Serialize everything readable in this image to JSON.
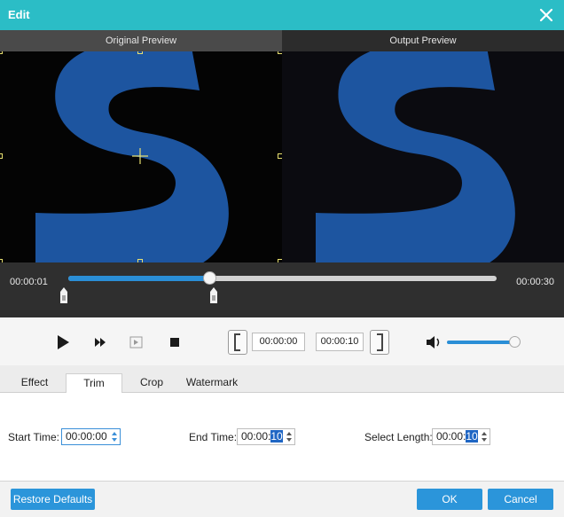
{
  "window": {
    "title": "Edit"
  },
  "preview": {
    "original_label": "Original Preview",
    "output_label": "Output Preview"
  },
  "timeline": {
    "current_time": "00:00:01",
    "total_time": "00:00:30",
    "progress_fraction": 0.33
  },
  "controls": {
    "trim_start": "00:00:00",
    "trim_end": "00:00:10",
    "volume_fraction": 1.0
  },
  "tabs": [
    {
      "label": "Effect"
    },
    {
      "label": "Trim"
    },
    {
      "label": "Crop"
    },
    {
      "label": "Watermark"
    }
  ],
  "active_tab": "Trim",
  "trim": {
    "start_label": "Start Time:",
    "start_value": "00:00:00",
    "end_label": "End Time:",
    "end_value_prefix": "00:00:",
    "end_value_selected": "10",
    "length_label": "Select Length:",
    "length_value_prefix": "00:00:",
    "length_value_selected": "10"
  },
  "footer": {
    "restore_label": "Restore Defaults",
    "ok_label": "OK",
    "cancel_label": "Cancel"
  },
  "colors": {
    "titlebar": "#2bbdc6",
    "accent": "#2b95da",
    "logo_blue": "#1d55a0"
  }
}
